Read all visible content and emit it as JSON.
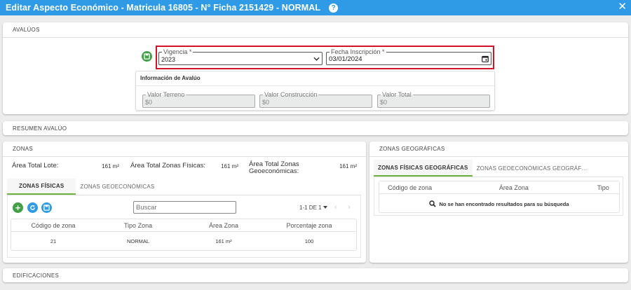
{
  "window": {
    "title": "Editar Aspecto Económico - Matricula 16805 - N° Ficha 2151429 - NORMAL",
    "help_icon": "?",
    "close_icon": "✕"
  },
  "avaluos": {
    "header": "AVALÚOS",
    "vigencia": {
      "label": "Vigencia *",
      "value": "2023"
    },
    "fecha_inscripcion": {
      "label": "Fecha Inscripción *",
      "value": "03/01/2024"
    },
    "info_title": "Información de Avalúo",
    "valor_terreno": {
      "label": "Valor Terreno",
      "value": "$0"
    },
    "valor_construccion": {
      "label": "Valor Construcción",
      "value": "$0"
    },
    "valor_total": {
      "label": "Valor Total",
      "value": "$0"
    }
  },
  "resumen": {
    "header": "RESUMEN AVALÚO"
  },
  "zonas": {
    "header": "ZONAS",
    "area_total_lote": {
      "label": "Área Total Lote:",
      "value": "161 m²"
    },
    "area_zonas_fisicas": {
      "label": "Área Total Zonas Físicas:",
      "value": "161 m²"
    },
    "area_zonas_geo": {
      "label": "Área Total Zonas Geoeconómicas:",
      "value": "161 m²"
    },
    "tabs": [
      "ZONAS FÍSICAS",
      "ZONAS GEOECONÓMICAS"
    ],
    "search_placeholder": "Buscar",
    "pagination": "1-1 DE 1",
    "columns": [
      "Código de zona",
      "Tipo Zona",
      "Área Zona",
      "Porcentaje zona"
    ],
    "rows": [
      [
        "21",
        "NORMAL",
        "161 m²",
        "100"
      ]
    ]
  },
  "zonas_geograficas": {
    "header": "ZONAS GEOGRÁFICAS",
    "tabs": [
      "ZONAS FÍSICAS GEOGRÁFICAS",
      "ZONAS GEOECONÓMICAS GEOGRÁF…"
    ],
    "columns": [
      "Código de zona",
      "Área Zona",
      "Tipo"
    ],
    "empty_message": "No se han encontrado resultados para su búsqueda"
  },
  "edificaciones": {
    "header": "EDIFICACIONES"
  },
  "colors": {
    "topbar": "#2f9be6",
    "green": "#43a047",
    "blue": "#2f9be6",
    "highlight": "#d3132a"
  }
}
